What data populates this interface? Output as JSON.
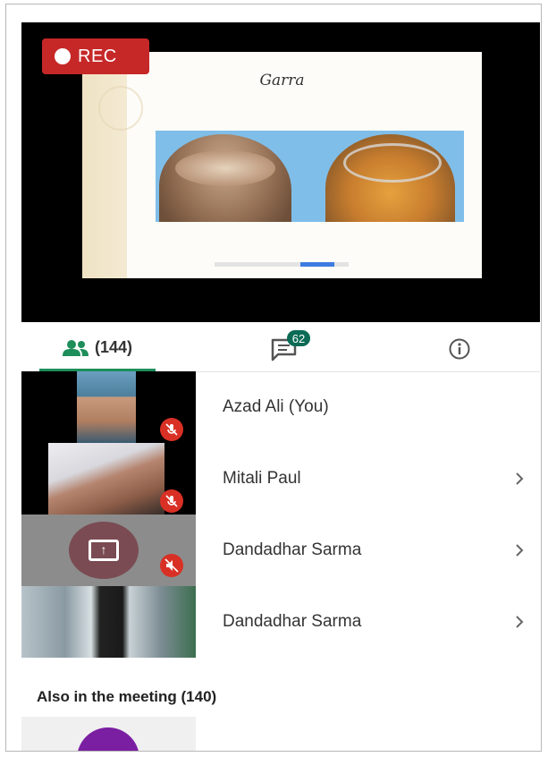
{
  "video": {
    "rec_label": "REC",
    "slide_title": "Garra"
  },
  "tabs": {
    "people_count": "(144)",
    "chat_badge": "62"
  },
  "participants": [
    {
      "name": "Azad Ali (You)"
    },
    {
      "name": "Mitali Paul"
    },
    {
      "name": "Dandadhar Sarma"
    },
    {
      "name": "Dandadhar Sarma"
    }
  ],
  "also_in_meeting": "Also in the meeting (140)",
  "icons": {
    "people": "people-icon",
    "chat": "chat-icon",
    "info": "info-icon",
    "mic_off": "mic-off-icon",
    "present": "present-screen-icon",
    "chevron": "chevron-right-icon"
  },
  "colors": {
    "rec": "#c62828",
    "accent": "#1e8e5a",
    "badge": "#0b6b55",
    "mic_off": "#d93025"
  }
}
